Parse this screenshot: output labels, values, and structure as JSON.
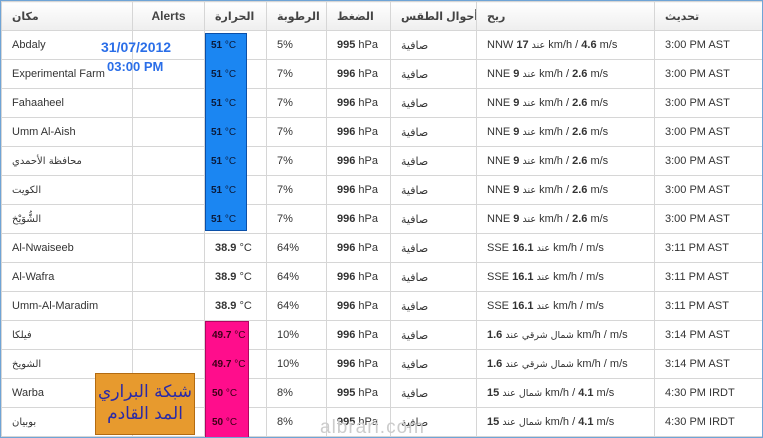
{
  "headers": {
    "location": "مكان",
    "alerts": "Alerts",
    "temperature": "الحرارة",
    "humidity": "الرطوبة",
    "pressure": "الضغط",
    "conditions": "أحوال الطقس",
    "wind": "ريح",
    "updated": "تحديث"
  },
  "stamp": {
    "date": "31/07/2012",
    "time": "03:00 PM"
  },
  "brand": {
    "line1": "شبكة البراري",
    "line2": "المد القادم"
  },
  "watermark": "albrari.com",
  "colors": {
    "blue_highlight": "#1b86f2",
    "pink_highlight": "#ff0d8c",
    "brand_orange": "#e79a2e",
    "link_blue": "#3a5fa8"
  },
  "rows": [
    {
      "location": "Abdaly",
      "temp": "51",
      "unit": "°C",
      "humidity": "5%",
      "pressure": "995",
      "pressure_unit": "hPa",
      "conditions": "صافية",
      "wind_dir": "NNW",
      "wind_speed": "17",
      "wind_mid": "عند",
      "wind_kmh": "km/h /",
      "wind_ms": "4.6",
      "wind_ms_unit": "m/s",
      "updated": "3:00 PM AST",
      "highlight": "blue"
    },
    {
      "location": "Experimental Farm",
      "temp": "51",
      "unit": "°C",
      "humidity": "7%",
      "pressure": "996",
      "pressure_unit": "hPa",
      "conditions": "صافية",
      "wind_dir": "NNE",
      "wind_speed": "9",
      "wind_mid": "عند",
      "wind_kmh": "km/h /",
      "wind_ms": "2.6",
      "wind_ms_unit": "m/s",
      "updated": "3:00 PM AST",
      "highlight": "blue"
    },
    {
      "location": "Fahaaheel",
      "temp": "51",
      "unit": "°C",
      "humidity": "7%",
      "pressure": "996",
      "pressure_unit": "hPa",
      "conditions": "صافية",
      "wind_dir": "NNE",
      "wind_speed": "9",
      "wind_mid": "عند",
      "wind_kmh": "km/h /",
      "wind_ms": "2.6",
      "wind_ms_unit": "m/s",
      "updated": "3:00 PM AST",
      "highlight": "blue"
    },
    {
      "location": "Umm Al-Aish",
      "temp": "51",
      "unit": "°C",
      "humidity": "7%",
      "pressure": "996",
      "pressure_unit": "hPa",
      "conditions": "صافية",
      "wind_dir": "NNE",
      "wind_speed": "9",
      "wind_mid": "عند",
      "wind_kmh": "km/h /",
      "wind_ms": "2.6",
      "wind_ms_unit": "m/s",
      "updated": "3:00 PM AST",
      "highlight": "blue"
    },
    {
      "location": "محافظة الأحمدي",
      "temp": "51",
      "unit": "°C",
      "humidity": "7%",
      "pressure": "996",
      "pressure_unit": "hPa",
      "conditions": "صافية",
      "wind_dir": "NNE",
      "wind_speed": "9",
      "wind_mid": "عند",
      "wind_kmh": "km/h /",
      "wind_ms": "2.6",
      "wind_ms_unit": "m/s",
      "updated": "3:00 PM AST",
      "highlight": "blue"
    },
    {
      "location": "الكويت",
      "temp": "51",
      "unit": "°C",
      "humidity": "7%",
      "pressure": "996",
      "pressure_unit": "hPa",
      "conditions": "صافية",
      "wind_dir": "NNE",
      "wind_speed": "9",
      "wind_mid": "عند",
      "wind_kmh": "km/h /",
      "wind_ms": "2.6",
      "wind_ms_unit": "m/s",
      "updated": "3:00 PM AST",
      "highlight": "blue"
    },
    {
      "location": "الشُّوَيْخ",
      "temp": "51",
      "unit": "°C",
      "humidity": "7%",
      "pressure": "996",
      "pressure_unit": "hPa",
      "conditions": "صافية",
      "wind_dir": "NNE",
      "wind_speed": "9",
      "wind_mid": "عند",
      "wind_kmh": "km/h /",
      "wind_ms": "2.6",
      "wind_ms_unit": "m/s",
      "updated": "3:00 PM AST",
      "highlight": "blue"
    },
    {
      "location": "Al-Nwaiseeb",
      "temp": "38.9",
      "unit": "°C",
      "humidity": "64%",
      "pressure": "996",
      "pressure_unit": "hPa",
      "conditions": "صافية",
      "wind_dir": "SSE",
      "wind_speed": "16.1",
      "wind_mid": "عند",
      "wind_kmh": "km/h /",
      "wind_ms": "",
      "wind_ms_unit": "m/s",
      "updated": "3:11 PM AST",
      "highlight": ""
    },
    {
      "location": "Al-Wafra",
      "temp": "38.9",
      "unit": "°C",
      "humidity": "64%",
      "pressure": "996",
      "pressure_unit": "hPa",
      "conditions": "صافية",
      "wind_dir": "SSE",
      "wind_speed": "16.1",
      "wind_mid": "عند",
      "wind_kmh": "km/h /",
      "wind_ms": "",
      "wind_ms_unit": "m/s",
      "updated": "3:11 PM AST",
      "highlight": ""
    },
    {
      "location": "Umm-Al-Maradim",
      "temp": "38.9",
      "unit": "°C",
      "humidity": "64%",
      "pressure": "996",
      "pressure_unit": "hPa",
      "conditions": "صافية",
      "wind_dir": "SSE",
      "wind_speed": "16.1",
      "wind_mid": "عند",
      "wind_kmh": "km/h /",
      "wind_ms": "",
      "wind_ms_unit": "m/s",
      "updated": "3:11 PM AST",
      "highlight": ""
    },
    {
      "location": "فيلكا",
      "temp": "49.7",
      "unit": "°C",
      "humidity": "10%",
      "pressure": "996",
      "pressure_unit": "hPa",
      "conditions": "صافية",
      "wind_dir": "",
      "wind_speed": "1.6",
      "wind_mid": "شمال شرقي عند",
      "wind_kmh": "km/h /",
      "wind_ms": "",
      "wind_ms_unit": "m/s",
      "updated": "3:14 PM AST",
      "highlight": "pink"
    },
    {
      "location": "الشويخ",
      "temp": "49.7",
      "unit": "°C",
      "humidity": "10%",
      "pressure": "996",
      "pressure_unit": "hPa",
      "conditions": "صافية",
      "wind_dir": "",
      "wind_speed": "1.6",
      "wind_mid": "شمال شرقي عند",
      "wind_kmh": "km/h /",
      "wind_ms": "",
      "wind_ms_unit": "m/s",
      "updated": "3:14 PM AST",
      "highlight": "pink"
    },
    {
      "location": "Warba",
      "temp": "50",
      "unit": "°C",
      "humidity": "8%",
      "pressure": "995",
      "pressure_unit": "hPa",
      "conditions": "صافية",
      "wind_dir": "",
      "wind_speed": "15",
      "wind_mid": "شمال عند",
      "wind_kmh": "km/h /",
      "wind_ms": "4.1",
      "wind_ms_unit": "m/s",
      "updated": "4:30 PM IRDT",
      "highlight": "pink"
    },
    {
      "location": "بوبيان",
      "temp": "50",
      "unit": "°C",
      "humidity": "8%",
      "pressure": "995",
      "pressure_unit": "hPa",
      "conditions": "صافية",
      "wind_dir": "",
      "wind_speed": "15",
      "wind_mid": "شمال عند",
      "wind_kmh": "km/h /",
      "wind_ms": "4.1",
      "wind_ms_unit": "m/s",
      "updated": "4:30 PM IRDT",
      "highlight": "pink"
    }
  ]
}
